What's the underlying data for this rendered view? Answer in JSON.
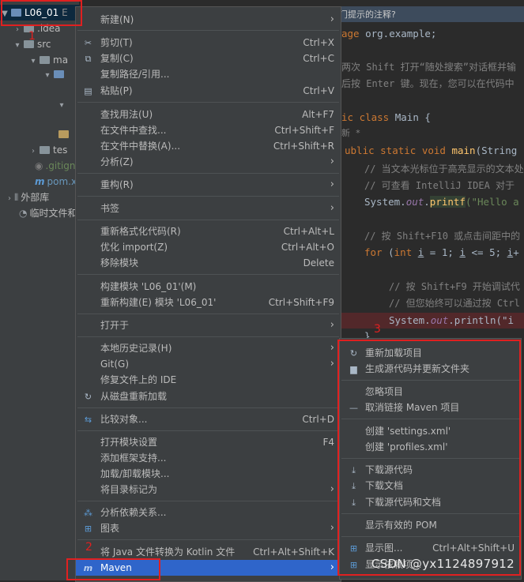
{
  "project_tree": {
    "root_label": "L06_01",
    "root_suffix": "E",
    "idea": ".idea",
    "src": "src",
    "main": "ma",
    "test": "tes",
    "gitignore": ".gitign",
    "pom": "pom.x",
    "external_libs": "外部库",
    "scratches": "临时文件和"
  },
  "editor": {
    "tip": "门提示的注释?",
    "lines": {
      "l1_kw": "age",
      "l1_rest": " org.example;",
      "l2": "两次 Shift 打开“随处搜索”对话框并输",
      "l3": "后按 Enter 键。现在，您可以在代码中",
      "l4_kw": "ic class",
      "l4_rest": " Main {",
      "l5": "新 *",
      "l6_kw": "ublic static void",
      "l6_fn": "main",
      "l6_rest": "(String",
      "l7": "// 当文本光标位于高亮显示的文本处",
      "l8": "// 可查看 IntelliJ IDEA 对于",
      "l9_a": "System.",
      "l9_out": "out",
      "l9_b": ".",
      "l9_fn": "printf",
      "l9_str": "(\"Hello a",
      "l10": "// 按 Shift+F10 或点击间距中的",
      "l11_kw": "for",
      "l11_a": " (",
      "l11_int": "int",
      "l11_b": " ",
      "l11_i1": "i",
      "l11_c": " = 1; ",
      "l11_i2": "i",
      "l11_d": " <= 5; ",
      "l11_i3": "i",
      "l11_e": "+",
      "l12": "// 按 Shift+F9 开始调试代",
      "l13": "// 但您始终可以通过按 Ctrl",
      "l14_a": "System.",
      "l14_out": "out",
      "l14_b": ".println(\"i ",
      "l15": "}"
    }
  },
  "context_menu": {
    "new": {
      "label": "新建(N)"
    },
    "cut": {
      "label": "剪切(T)",
      "shortcut": "Ctrl+X"
    },
    "copy": {
      "label": "复制(C)",
      "shortcut": "Ctrl+C"
    },
    "copy_path": {
      "label": "复制路径/引用..."
    },
    "paste": {
      "label": "粘贴(P)",
      "shortcut": "Ctrl+V"
    },
    "find_usages": {
      "label": "查找用法(U)",
      "shortcut": "Alt+F7"
    },
    "find_in_files": {
      "label": "在文件中查找...",
      "shortcut": "Ctrl+Shift+F"
    },
    "replace_in_files": {
      "label": "在文件中替换(A)...",
      "shortcut": "Ctrl+Shift+R"
    },
    "analyze": {
      "label": "分析(Z)"
    },
    "refactor": {
      "label": "重构(R)"
    },
    "bookmarks": {
      "label": "书签"
    },
    "reformat": {
      "label": "重新格式化代码(R)",
      "shortcut": "Ctrl+Alt+L"
    },
    "optimize_imports": {
      "label": "优化 import(Z)",
      "shortcut": "Ctrl+Alt+O"
    },
    "delete": {
      "label": "移除模块",
      "shortcut": "Delete"
    },
    "build_module": {
      "label": "构建模块 'L06_01'(M)"
    },
    "rebuild_module": {
      "label": "重新构建(E) 模块 'L06_01'",
      "shortcut": "Ctrl+Shift+F9"
    },
    "open_in": {
      "label": "打开于"
    },
    "local_history": {
      "label": "本地历史记录(H)"
    },
    "git": {
      "label": "Git(G)"
    },
    "repair_ide": {
      "label": "修复文件上的 IDE"
    },
    "reload_from_disk": {
      "label": "从磁盘重新加载"
    },
    "compare_with": {
      "label": "比较对象...",
      "shortcut": "Ctrl+D"
    },
    "module_settings": {
      "label": "打开模块设置",
      "shortcut": "F4"
    },
    "add_framework": {
      "label": "添加框架支持..."
    },
    "load_unload": {
      "label": "加载/卸载模块..."
    },
    "mark_dir": {
      "label": "将目录标记为"
    },
    "analyze_deps": {
      "label": "分析依赖关系..."
    },
    "diagrams": {
      "label": "图表"
    },
    "convert_kotlin": {
      "label": "将 Java 文件转换为 Kotlin 文件",
      "shortcut": "Ctrl+Alt+Shift+K"
    },
    "maven": {
      "label": "Maven"
    }
  },
  "maven_menu": {
    "reload": {
      "label": "重新加载项目"
    },
    "generate_sources": {
      "label": "生成源代码并更新文件夹"
    },
    "ignore": {
      "label": "忽略项目"
    },
    "unlink": {
      "label": "取消链接 Maven 项目"
    },
    "create_settings": {
      "label": "创建 'settings.xml'"
    },
    "create_profiles": {
      "label": "创建 'profiles.xml'"
    },
    "download_sources": {
      "label": "下载源代码"
    },
    "download_docs": {
      "label": "下载文档"
    },
    "download_both": {
      "label": "下载源代码和文档"
    },
    "effective_pom": {
      "label": "显示有效的 POM"
    },
    "show_diagram": {
      "label": "显示图...",
      "shortcut": "Ctrl+Alt+Shift+U"
    },
    "show_deps": {
      "label": "显示依赖项..."
    }
  },
  "annotations": {
    "one": "1",
    "two": "2",
    "three": "3"
  },
  "watermark": "CSDN @yx1124897912",
  "colors": {
    "menu_bg": "#3c3f41",
    "highlight": "#2f65ca",
    "annotation": "#e02020",
    "editor_bg": "#2b2b2b"
  }
}
